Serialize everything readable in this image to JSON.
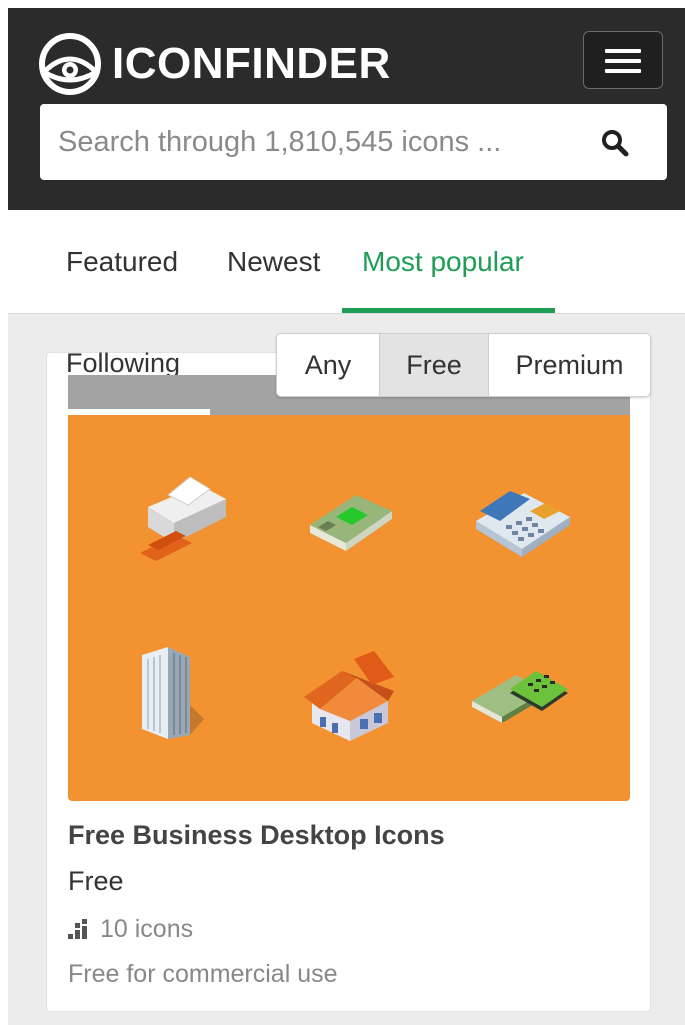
{
  "header": {
    "logo_text": "ICONFINDER",
    "search": {
      "placeholder": "Search through 1,810,545 icons ..."
    },
    "icons": {
      "logo": "eye-logo-icon",
      "menu": "hamburger-menu-icon",
      "search": "magnifier-search-icon"
    }
  },
  "tabs": [
    {
      "label": "Featured",
      "active": false
    },
    {
      "label": "Newest",
      "active": false
    },
    {
      "label": "Most popular",
      "active": true
    }
  ],
  "filter": {
    "following_label": "Following",
    "options": [
      {
        "label": "Any",
        "selected": false
      },
      {
        "label": "Free",
        "selected": true
      },
      {
        "label": "Premium",
        "selected": false
      }
    ]
  },
  "iconset": {
    "title": "Free Business Desktop Icons",
    "price": "Free",
    "count": "10 icons",
    "license": "Free for commercial use",
    "preview_icons": [
      "printer-icon",
      "money-stack-icon",
      "telephone-icon",
      "office-building-icon",
      "house-icon",
      "calculator-money-icon"
    ]
  },
  "colors": {
    "header_bg": "#2b2b2b",
    "accent_green": "#1e9e55",
    "preview_bg": "#f39230",
    "page_bg": "#ececec"
  }
}
